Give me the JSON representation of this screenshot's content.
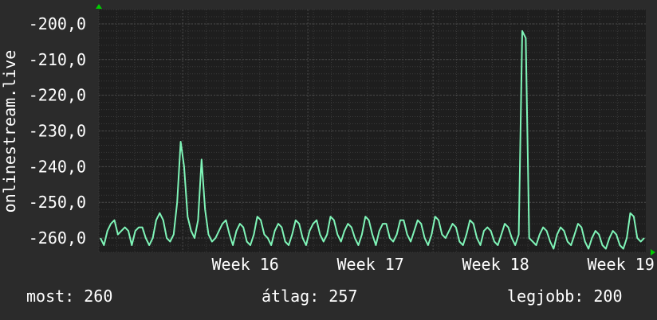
{
  "colors": {
    "background": "#2b2b2b",
    "plot_background": "#1e1e1e",
    "grid_major": "#4a4a4a",
    "grid_minor": "#3a3a3a",
    "line": "#7ff5b8",
    "axis_arrow": "#00cc00",
    "text": "#ffffff"
  },
  "chart_data": {
    "type": "line",
    "ylabel": "onlinestream.live",
    "ylim": [
      -264,
      -196
    ],
    "y_ticks": [
      "-200,0",
      "-210,0",
      "-220,0",
      "-230,0",
      "-240,0",
      "-250,0",
      "-260,0"
    ],
    "y_tick_values": [
      -200,
      -210,
      -220,
      -230,
      -240,
      -250,
      -260
    ],
    "x_ticks": [
      "Week 16",
      "Week 17",
      "Week 18",
      "Week 19"
    ],
    "x_tick_positions": [
      16,
      17,
      18,
      19
    ],
    "xlim": [
      15.33,
      19.7
    ],
    "grid": true,
    "series": [
      {
        "values": [
          -260,
          -262,
          -258,
          -256,
          -255,
          -259,
          -258,
          -257,
          -258,
          -262,
          -258,
          -257,
          -257,
          -260,
          -262,
          -260,
          -255,
          -253,
          -255,
          -260,
          -261,
          -259,
          -250,
          -233,
          -240,
          -254,
          -258,
          -260,
          -255,
          -238,
          -252,
          -259,
          -261,
          -260,
          -258,
          -256,
          -255,
          -259,
          -262,
          -258,
          -256,
          -257,
          -261,
          -262,
          -259,
          -254,
          -255,
          -259,
          -260,
          -262,
          -258,
          -256,
          -257,
          -261,
          -262,
          -259,
          -255,
          -256,
          -260,
          -262,
          -258,
          -256,
          -255,
          -259,
          -261,
          -259,
          -254,
          -255,
          -259,
          -261,
          -258,
          -256,
          -257,
          -260,
          -262,
          -259,
          -254,
          -255,
          -259,
          -262,
          -258,
          -256,
          -256,
          -260,
          -261,
          -259,
          -255,
          -255,
          -259,
          -261,
          -258,
          -255,
          -256,
          -260,
          -262,
          -259,
          -254,
          -255,
          -259,
          -260,
          -258,
          -256,
          -257,
          -261,
          -262,
          -259,
          -255,
          -256,
          -260,
          -262,
          -258,
          -257,
          -258,
          -261,
          -262,
          -259,
          -256,
          -257,
          -260,
          -262,
          -259,
          -202,
          -204,
          -260,
          -261,
          -262,
          -259,
          -257,
          -258,
          -261,
          -263,
          -259,
          -257,
          -258,
          -261,
          -262,
          -259,
          -256,
          -257,
          -261,
          -263,
          -260,
          -258,
          -259,
          -262,
          -263,
          -260,
          -258,
          -259,
          -262,
          -263,
          -260,
          -253,
          -254,
          -260,
          -261,
          -260
        ]
      }
    ]
  },
  "stats": {
    "now_label": "most:",
    "now_value": "260",
    "avg_label": "átlag:",
    "avg_value": "257",
    "best_label": "legjobb:",
    "best_value": "200"
  }
}
